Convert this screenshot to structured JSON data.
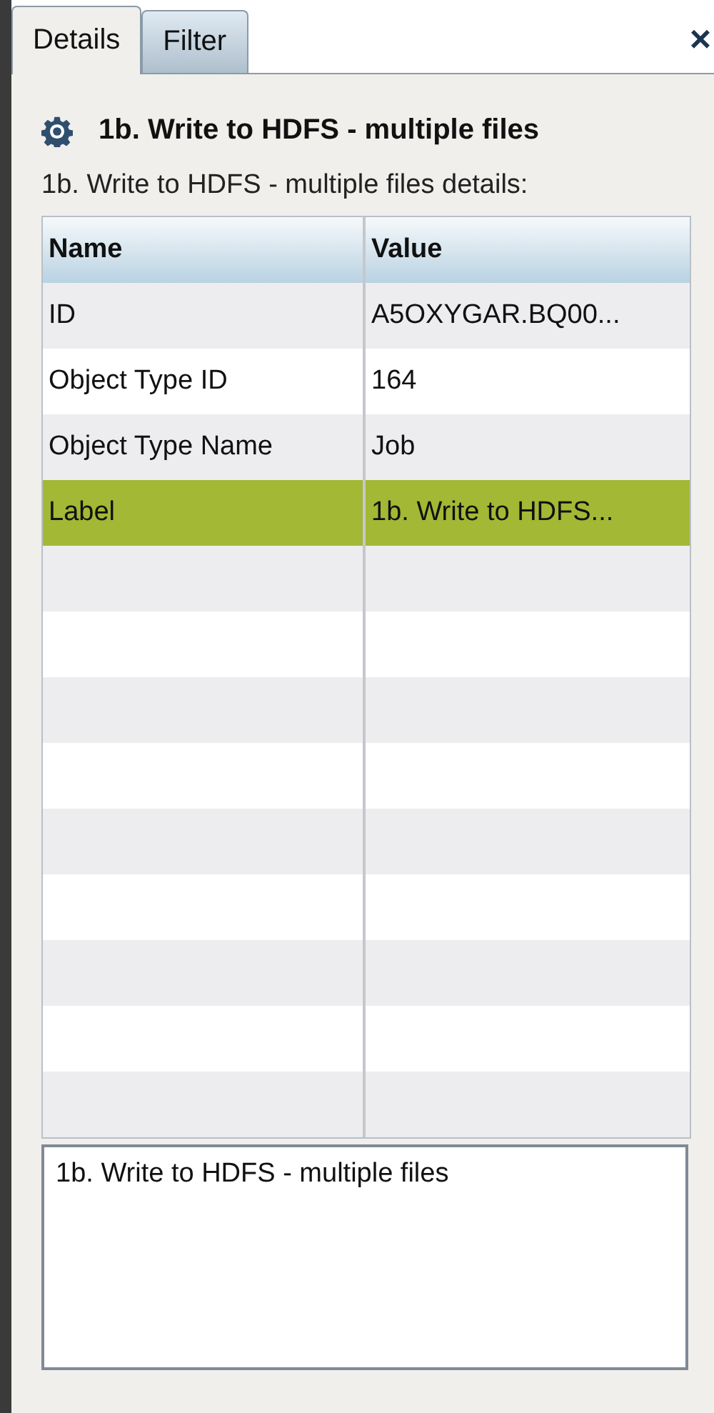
{
  "tabs": [
    {
      "label": "Details",
      "selected": true
    },
    {
      "label": "Filter",
      "selected": false
    }
  ],
  "close": "×",
  "header": {
    "title": "1b. Write to HDFS - multiple files"
  },
  "subtitle": "1b. Write to HDFS - multiple files details:",
  "table": {
    "columns": [
      "Name",
      "Value"
    ],
    "rows": [
      {
        "name": "ID",
        "value": "A5OXYGAR.BQ00...",
        "selected": false
      },
      {
        "name": "Object Type ID",
        "value": "164",
        "selected": false
      },
      {
        "name": "Object Type Name",
        "value": "Job",
        "selected": false
      },
      {
        "name": "Label",
        "value": "1b. Write to HDFS...",
        "selected": true
      }
    ]
  },
  "description": {
    "value": "1b. Write to HDFS - multiple files"
  }
}
